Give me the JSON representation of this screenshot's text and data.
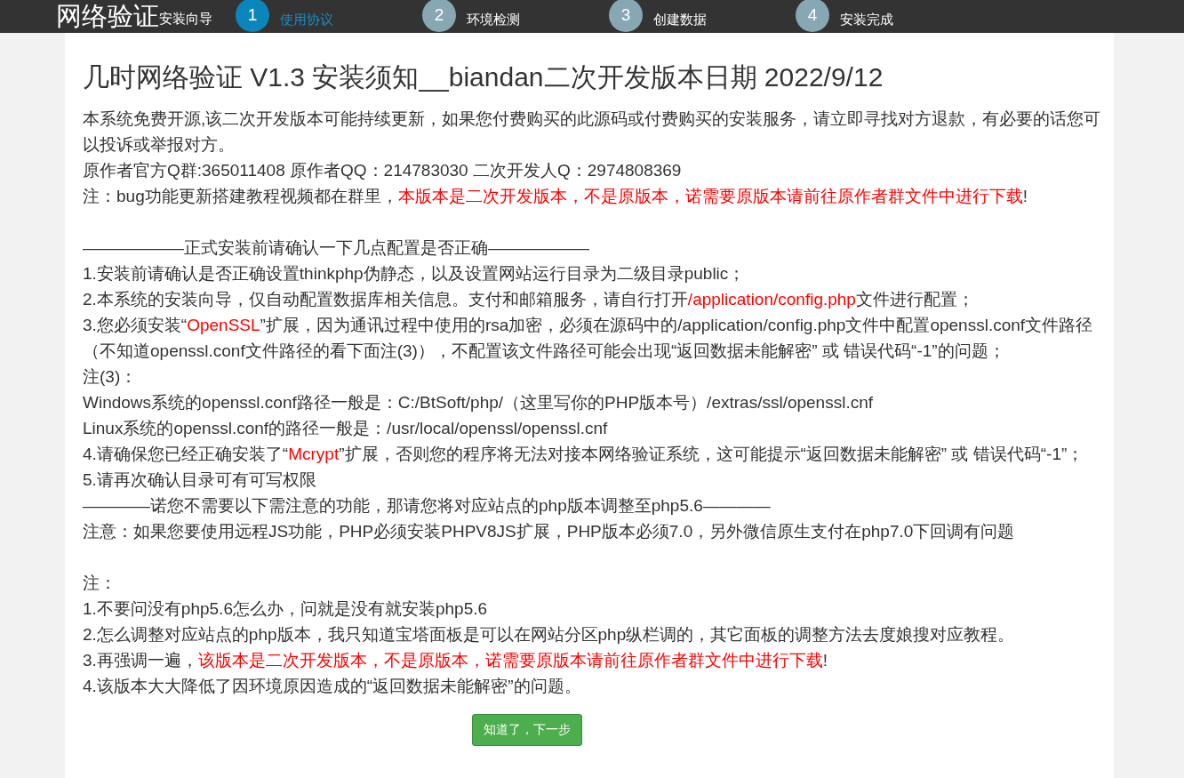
{
  "header": {
    "logo": "网络验证",
    "subtitle": "安装向导",
    "steps": [
      {
        "number": "1",
        "label": "使用协议",
        "selected": true
      },
      {
        "number": "2",
        "label": "环境检测",
        "selected": false
      },
      {
        "number": "3",
        "label": "创建数据",
        "selected": false
      },
      {
        "number": "4",
        "label": "安装完成",
        "selected": false
      }
    ]
  },
  "title": "几时网络验证 V1.3 安装须知__biandan二次开发版本日期 2022/9/12",
  "blocks": [
    {
      "lines": [
        [
          {
            "text": "本系统免费开源,该二次开发版本可能持续更新，如果您付费购买的此源码或付费购买的安装服务，请立即寻找对方退款，有必要的话您可以投诉或举报对方。",
            "red": false
          }
        ],
        [
          {
            "text": "原作者官方Q群:365011408 原作者QQ：214783030 二次开发人Q：2974808369",
            "red": false
          }
        ],
        [
          {
            "text": "注：bug功能更新搭建教程视频都在群里，",
            "red": false
          },
          {
            "text": "本版本是二次开发版本，不是原版本，诺需要原版本请前往原作者群文件中进行下载",
            "red": true
          },
          {
            "text": "!",
            "red": false
          }
        ]
      ]
    },
    {
      "lines": [
        [
          {
            "text": "——————正式安装前请确认一下几点配置是否正确——————",
            "red": false
          }
        ],
        [
          {
            "text": "1.安装前请确认是否正确设置thinkphp伪静态，以及设置网站运行目录为二级目录public；",
            "red": false
          }
        ],
        [
          {
            "text": "2.本系统的安装向导，仅自动配置数据库相关信息。支付和邮箱服务，请自行打开",
            "red": false
          },
          {
            "text": "/application/config.php",
            "red": true
          },
          {
            "text": "文件进行配置；",
            "red": false
          }
        ],
        [
          {
            "text": "3.您必须安装“",
            "red": false
          },
          {
            "text": "OpenSSL",
            "red": true
          },
          {
            "text": "”扩展，因为通讯过程中使用的rsa加密，必须在源码中的/application/config.php文件中配置openssl.conf文件路径（不知道openssl.conf文件路径的看下面注(3)），不配置该文件路径可能会出现“返回数据未能解密” 或 错误代码“-1”的问题；",
            "red": false
          }
        ],
        [
          {
            "text": "注(3)：",
            "red": false
          }
        ],
        [
          {
            "text": "Windows系统的openssl.conf路径一般是：C:/BtSoft/php/（这里写你的PHP版本号）/extras/ssl/openssl.cnf",
            "red": false
          }
        ],
        [
          {
            "text": "Linux系统的openssl.conf的路径一般是：/usr/local/openssl/openssl.cnf",
            "red": false
          }
        ],
        [
          {
            "text": "4.请确保您已经正确安装了“",
            "red": false
          },
          {
            "text": "Mcrypt",
            "red": true
          },
          {
            "text": "”扩展，否则您的程序将无法对接本网络验证系统，这可能提示“返回数据未能解密” 或 错误代码“-1”；",
            "red": false
          }
        ],
        [
          {
            "text": "5.请再次确认目录可有可写权限",
            "red": false
          }
        ],
        [
          {
            "text": "————诺您不需要以下需注意的功能，那请您将对应站点的php版本调整至php5.6————",
            "red": false
          }
        ],
        [
          {
            "text": "注意：如果您要使用远程JS功能，PHP必须安装PHPV8JS扩展，PHP版本必须7.0，另外微信原生支付在php7.0下回调有问题",
            "red": false
          }
        ]
      ]
    },
    {
      "lines": [
        [
          {
            "text": "注：",
            "red": false
          }
        ],
        [
          {
            "text": "1.不要问没有php5.6怎么办，问就是没有就安装php5.6",
            "red": false
          }
        ],
        [
          {
            "text": "2.怎么调整对应站点的php版本，我只知道宝塔面板是可以在网站分区php纵栏调的，其它面板的调整方法去度娘搜对应教程。",
            "red": false
          }
        ],
        [
          {
            "text": "3.再强调一遍，",
            "red": false
          },
          {
            "text": "该版本是二次开发版本，不是原版本，诺需要原版本请前往原作者群文件中进行下载",
            "red": true
          },
          {
            "text": "!",
            "red": false
          }
        ],
        [
          {
            "text": "4.该版本大大降低了因环境原因造成的“返回数据未能解密”的问题。",
            "red": false
          }
        ]
      ]
    }
  ],
  "button": "知道了，下一步"
}
